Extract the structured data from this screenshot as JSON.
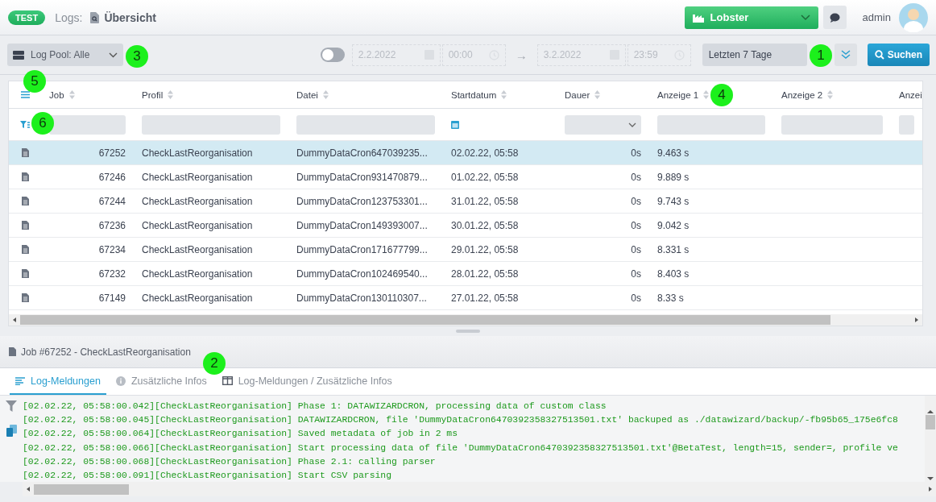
{
  "header": {
    "badge": "TEST",
    "section": "Logs:",
    "page_title": "Übersicht",
    "tenant": "Lobster",
    "user": "admin"
  },
  "toolbar": {
    "pool": "Log Pool: Alle",
    "range_toggle": {
      "on": false
    },
    "from_date": "2.2.2022",
    "from_time": "00:00",
    "arrow": "→",
    "to_date": "3.2.2022",
    "to_time": "23:59",
    "preset": "Letzten 7 Tage",
    "search_button": "Suchen"
  },
  "table": {
    "columns": [
      "Job",
      "Profil",
      "Datei",
      "Startdatum",
      "Dauer",
      "Anzeige 1",
      "Anzeige 2",
      "Anzei"
    ],
    "rows": [
      {
        "selected": true,
        "cells": [
          "67252",
          "CheckLastReorganisation",
          "DummyDataCron647039235...",
          "02.02.22, 05:58",
          "0s",
          "9.463 s"
        ]
      },
      {
        "selected": false,
        "cells": [
          "67246",
          "CheckLastReorganisation",
          "DummyDataCron931470879...",
          "01.02.22, 05:58",
          "0s",
          "9.889 s"
        ]
      },
      {
        "selected": false,
        "cells": [
          "67244",
          "CheckLastReorganisation",
          "DummyDataCron123753301...",
          "31.01.22, 05:58",
          "0s",
          "9.743 s"
        ]
      },
      {
        "selected": false,
        "cells": [
          "67236",
          "CheckLastReorganisation",
          "DummyDataCron149393007...",
          "30.01.22, 05:58",
          "0s",
          "9.042 s"
        ]
      },
      {
        "selected": false,
        "cells": [
          "67234",
          "CheckLastReorganisation",
          "DummyDataCron171677799...",
          "29.01.22, 05:58",
          "0s",
          "8.331 s"
        ]
      },
      {
        "selected": false,
        "cells": [
          "67232",
          "CheckLastReorganisation",
          "DummyDataCron102469540...",
          "28.01.22, 05:58",
          "0s",
          "8.403 s"
        ]
      },
      {
        "selected": false,
        "cells": [
          "67149",
          "CheckLastReorganisation",
          "DummyDataCron130110307...",
          "27.01.22, 05:58",
          "0s",
          "8.33 s"
        ]
      }
    ]
  },
  "detail": {
    "title": "Job #67252 - CheckLastReorganisation",
    "tabs": [
      {
        "label": "Log-Meldungen",
        "selected": true,
        "kind": "lines"
      },
      {
        "label": "Zusätzliche Infos",
        "selected": false,
        "kind": "info"
      },
      {
        "label": "Log-Meldungen / Zusätzliche Infos",
        "selected": false,
        "kind": "split"
      }
    ],
    "log_lines": [
      "[02.02.22, 05:58:00.042][CheckLastReorganisation] Phase 1: DATAWIZARDCRON, processing data of custom class",
      "[02.02.22, 05:58:00.045][CheckLastReorganisation] DATAWIZARDCRON, file 'DummyDataCron6470392358327513501.txt' backuped as ./datawizard/backup/-fb95b65_175e6fc8",
      "[02.02.22, 05:58:00.064][CheckLastReorganisation] Saved metadata of job in 2 ms",
      "[02.02.22, 05:58:00.066][CheckLastReorganisation] Start processing data of file 'DummyDataCron6470392358327513501.txt'@BetaTest, length=15, sender=, profile ve",
      "[02.02.22, 05:58:00.068][CheckLastReorganisation] Phase 2.1: calling parser",
      "[02.02.22, 05:58:00.091][CheckLastReorganisation] Start CSV parsing"
    ]
  },
  "callouts": [
    "1",
    "2",
    "3",
    "4",
    "5",
    "6"
  ]
}
